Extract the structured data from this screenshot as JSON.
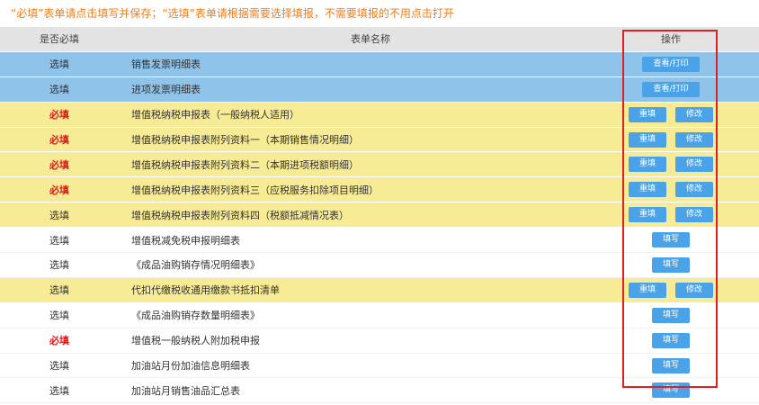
{
  "notice": "“必填”表单请点击填写并保存；“选填”表单请根据需要选择填报，不需要填报的不用点击打开",
  "headers": {
    "required": "是否必填",
    "name": "表单名称",
    "actions": "操作"
  },
  "rows": [
    {
      "req": "选填",
      "name": "销售发票明细表",
      "btn1": "查看/打印",
      "btn2": ""
    },
    {
      "req": "选填",
      "name": "进项发票明细表",
      "btn1": "查看/打印",
      "btn2": ""
    },
    {
      "req": "必填",
      "name": "增值税纳税申报表（一般纳税人适用）",
      "btn1": "重填",
      "btn2": "修改"
    },
    {
      "req": "必填",
      "name": "增值税纳税申报表附列资料一（本期销售情况明细）",
      "btn1": "重填",
      "btn2": "修改"
    },
    {
      "req": "必填",
      "name": "增值税纳税申报表附列资料二（本期进项税额明细）",
      "btn1": "重填",
      "btn2": "修改"
    },
    {
      "req": "必填",
      "name": "增值税纳税申报表附列资料三（应税服务扣除项目明细）",
      "btn1": "重填",
      "btn2": "修改"
    },
    {
      "req": "选填",
      "name": "增值税纳税申报表附列资料四（税额抵减情况表）",
      "btn1": "重填",
      "btn2": "修改"
    },
    {
      "req": "选填",
      "name": "增值税减免税申报明细表",
      "btn1": "填写",
      "btn2": ""
    },
    {
      "req": "选填",
      "name": "《成品油购销存情况明细表》",
      "btn1": "填写",
      "btn2": ""
    },
    {
      "req": "选填",
      "name": "代扣代缴税收通用缴款书抵扣清单",
      "btn1": "重填",
      "btn2": "修改"
    },
    {
      "req": "选填",
      "name": "《成品油购销存数量明细表》",
      "btn1": "填写",
      "btn2": ""
    },
    {
      "req": "必填",
      "name": "增值税一般纳税人附加税申报",
      "btn1": "填写",
      "btn2": ""
    },
    {
      "req": "选填",
      "name": "加油站月份加油信息明细表",
      "btn1": "填写",
      "btn2": ""
    },
    {
      "req": "选填",
      "name": "加油站月销售油品汇总表",
      "btn1": "填写",
      "btn2": ""
    }
  ],
  "colors": {
    "notice": "#f07c1b",
    "required": "#e01a1a",
    "blue_row": "#8fc3ea",
    "yellow_row": "#f8eb96",
    "button": "#4aa3e8",
    "highlight_box": "#e02020"
  }
}
